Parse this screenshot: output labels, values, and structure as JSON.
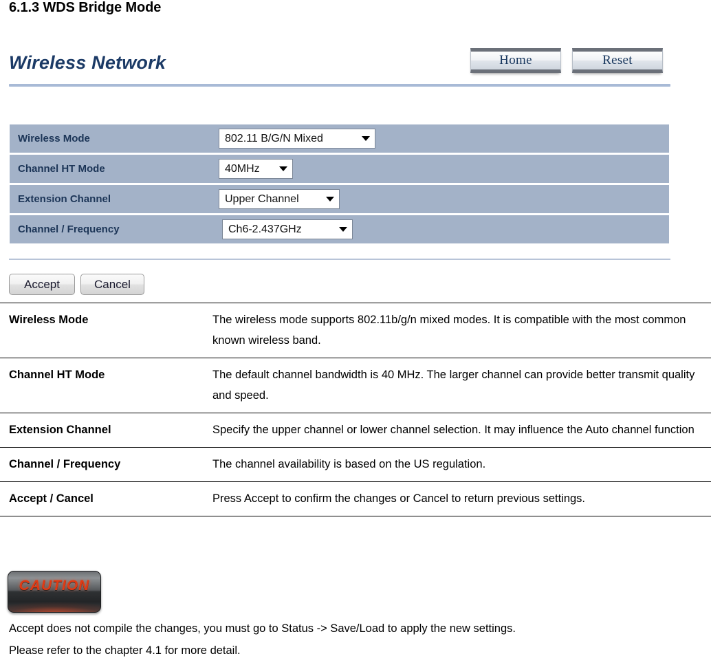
{
  "document": {
    "heading": "6.1.3 WDS Bridge Mode"
  },
  "panel": {
    "title": "Wireless Network",
    "nav_buttons": [
      {
        "label": "Home"
      },
      {
        "label": "Reset"
      }
    ],
    "settings": [
      {
        "label": "Wireless Mode",
        "value": "802.11 B/G/N Mixed"
      },
      {
        "label": "Channel HT Mode",
        "value": "40MHz"
      },
      {
        "label": "Extension Channel",
        "value": "Upper Channel"
      },
      {
        "label": "Channel / Frequency",
        "value": "Ch6-2.437GHz"
      }
    ],
    "actions": [
      {
        "label": "Accept"
      },
      {
        "label": "Cancel"
      }
    ],
    "colors": {
      "row_background": "#a3b2c8",
      "label_text": "#1c3557",
      "title_text": "#1b3a66",
      "rule": "#a8bad6"
    }
  },
  "descriptions": [
    {
      "term": "Wireless Mode",
      "definition": "The wireless mode supports 802.11b/g/n mixed modes. It is compatible with the most common known wireless band."
    },
    {
      "term": "Channel HT Mode",
      "definition": "The default channel bandwidth is 40 MHz. The larger channel can provide better transmit quality and speed."
    },
    {
      "term": "Extension Channel",
      "definition": "Specify the upper channel or lower channel selection. It may influence the Auto channel function"
    },
    {
      "term": "Channel / Frequency",
      "definition": "The channel availability is based on the US regulation."
    },
    {
      "term": "Accept / Cancel",
      "definition": "Press Accept to confirm the changes or Cancel to return previous settings."
    }
  ],
  "caution": {
    "label": "CAUTION",
    "color": "#e03a14",
    "note_line1": "Accept does not compile the changes, you must go to Status -> Save/Load to apply the new settings.",
    "note_line2": "Please refer to the chapter 4.1 for more detail."
  }
}
